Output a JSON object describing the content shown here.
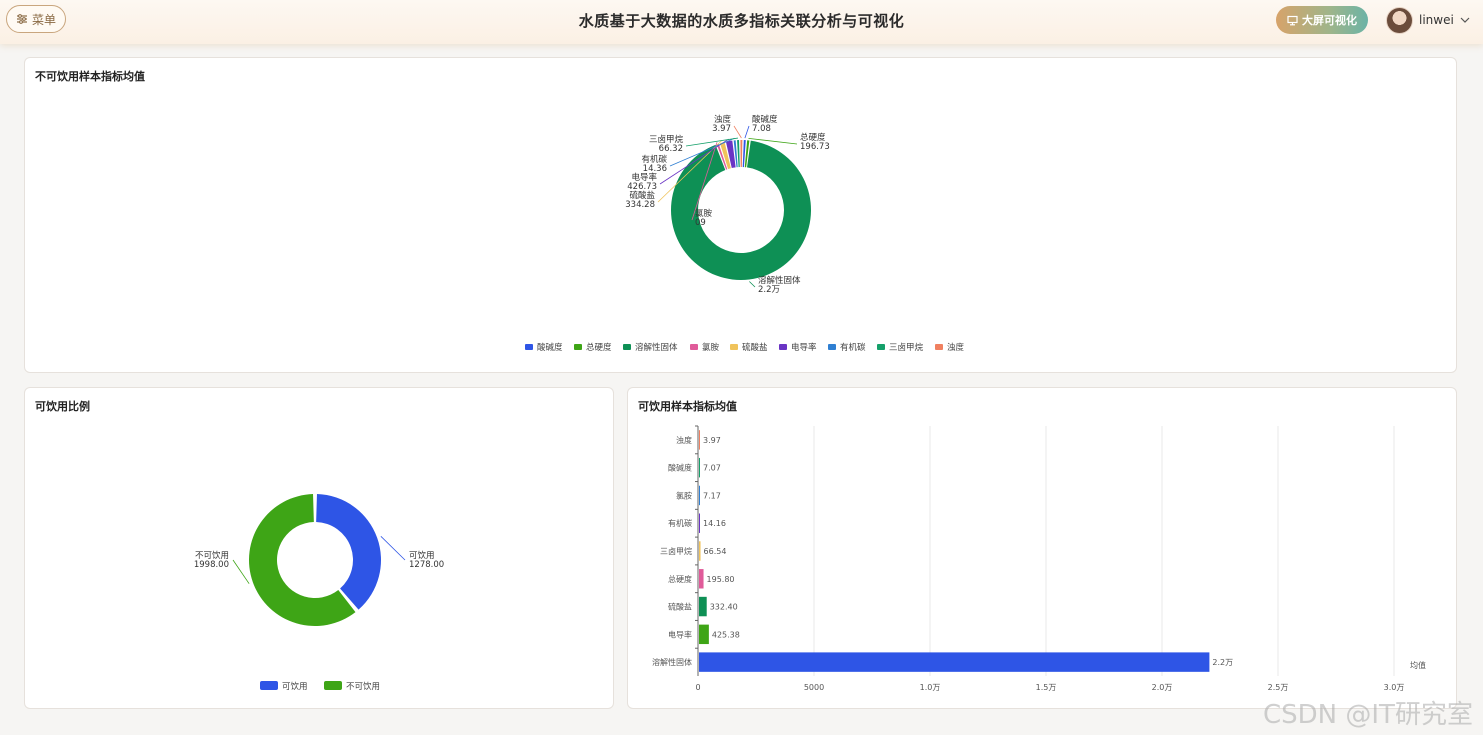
{
  "header": {
    "menu_label": "菜单",
    "title": "水质基于大数据的水质多指标关联分析与可视化",
    "screen_button": "大屏可视化",
    "username": "linwei"
  },
  "colors": {
    "blue": "#2e55e6",
    "green": "#3ea516",
    "teal": "#0e9055",
    "pink": "#e05b9a",
    "yellow": "#f0c35b",
    "purple": "#6a34c4",
    "lightblue": "#2f7fd2",
    "teal2": "#15a06a",
    "salmon": "#f08060"
  },
  "chart_data": [
    {
      "type": "pie",
      "title": "不可饮用样本指标均值",
      "legend_position": "bottom",
      "categories": [
        "酸碱度",
        "总硬度",
        "溶解性固体",
        "氯胺",
        "硫酸盐",
        "电导率",
        "有机碳",
        "三卤甲烷",
        "浊度"
      ],
      "values": [
        7.08,
        196.73,
        22000,
        7.09,
        334.28,
        426.73,
        14.36,
        66.32,
        3.97
      ],
      "value_labels": [
        "7.08",
        "196.73",
        "2.2万",
        "7.09",
        "334.28",
        "426.73",
        "14.36",
        "66.32",
        "3.97"
      ],
      "label_names": [
        "酸碱度",
        "总硬度",
        "溶解性固体",
        "氯胺",
        "硫酸盐",
        "电导率",
        "有机碳",
        "三卤甲烷",
        "浊度"
      ],
      "partial_label": "09"
    },
    {
      "type": "pie",
      "title": "可饮用比例",
      "legend_position": "bottom",
      "categories": [
        "可饮用",
        "不可饮用"
      ],
      "values": [
        1278.0,
        1998.0
      ],
      "value_labels": [
        "1278.00",
        "1998.00"
      ]
    },
    {
      "type": "bar",
      "orientation": "horizontal",
      "title": "可饮用样本指标均值",
      "categories": [
        "浊度",
        "酸碱度",
        "氯胺",
        "有机碳",
        "三卤甲烷",
        "总硬度",
        "硫酸盐",
        "电导率",
        "溶解性固体"
      ],
      "values": [
        3.97,
        7.07,
        7.17,
        14.16,
        66.54,
        195.8,
        332.4,
        425.38,
        22000
      ],
      "value_labels": [
        "3.97",
        "7.07",
        "7.17",
        "14.16",
        "66.54",
        "195.80",
        "332.40",
        "425.38",
        "2.2万"
      ],
      "xlim": [
        0,
        30000
      ],
      "x_ticks": [
        "0",
        "5000",
        "1.0万",
        "1.5万",
        "2.0万",
        "2.5万",
        "3.0万"
      ],
      "xlabel": "均值",
      "grid": true
    }
  ],
  "watermark": "CSDN @IT研究室"
}
